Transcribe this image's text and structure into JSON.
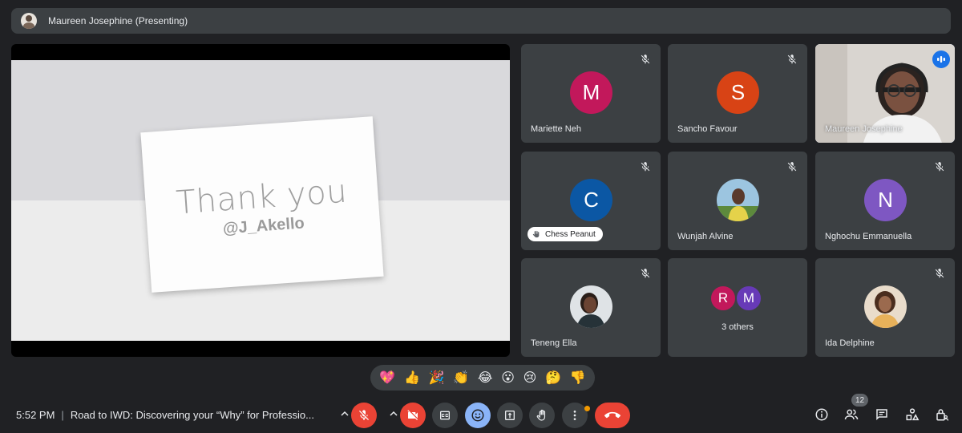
{
  "presenter": {
    "name": "Maureen Josephine (Presenting)"
  },
  "slide": {
    "title": "Thank you",
    "handle": "@J_Akello"
  },
  "tiles": [
    {
      "name": "Mariette Neh",
      "initial": "M",
      "color": "#c2185b"
    },
    {
      "name": "Sancho Favour",
      "initial": "S",
      "color": "#d84315"
    },
    {
      "name": "Maureen Josephine"
    },
    {
      "initial": "C",
      "color": "#0b57a4",
      "chip": "Chess Peanut"
    },
    {
      "name": "Wunjah Alvine"
    },
    {
      "name": "Nghochu Emmanuella",
      "initial": "N",
      "color": "#7e57c2"
    },
    {
      "name": "Teneng Ella"
    },
    {
      "others_label": "3 others",
      "others_initials": [
        "R",
        "M"
      ],
      "others_colors": [
        "#c2185b",
        "#673ab7"
      ]
    },
    {
      "name": "Ida Delphine"
    }
  ],
  "reactions": [
    "💖",
    "👍",
    "🎉",
    "👏",
    "😂",
    "😮",
    "😢",
    "🤔",
    "👎"
  ],
  "meeting": {
    "time": "5:52 PM",
    "separator": "|",
    "title": "Road to IWD: Discovering your “Why” for Professio..."
  },
  "participants_count": "12",
  "icons": {
    "mic": "mic-off-icon",
    "camera": "camera-off-icon",
    "captions": "captions-icon",
    "emoji": "emoji-icon",
    "present": "present-icon",
    "hand": "raise-hand-icon",
    "more": "more-options-icon",
    "end": "end-call-icon",
    "info": "info-icon",
    "people": "people-icon",
    "chat": "chat-icon",
    "activities": "activities-icon",
    "host": "host-controls-icon"
  }
}
